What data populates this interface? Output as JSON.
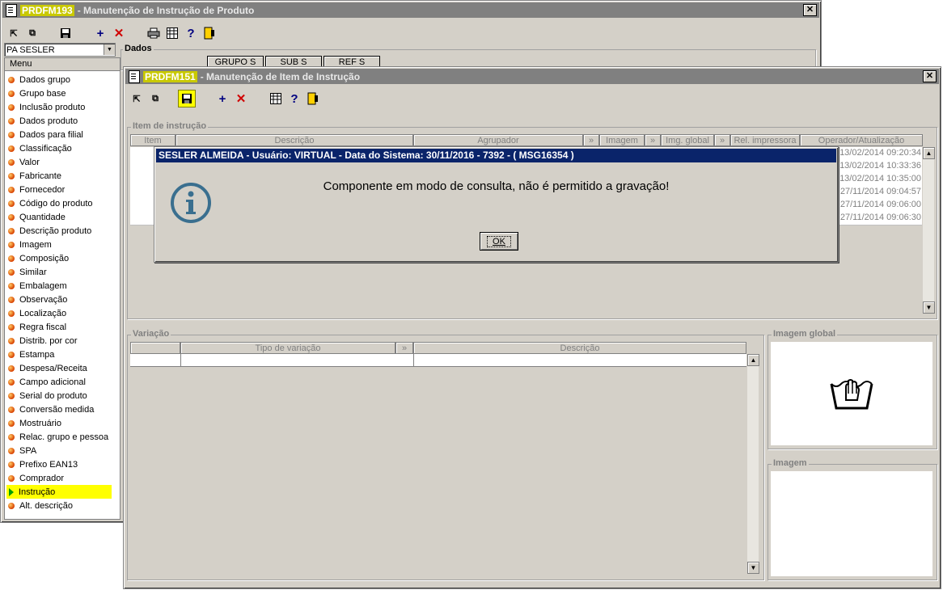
{
  "back_window": {
    "code": "PRDFM193",
    "title": "- Manutenção de Instrução de Produto",
    "combo_value": "PA SESLER",
    "menu_header": "Menu",
    "dados_label": "Dados",
    "tabs": [
      "GRUPO S",
      "SUB S",
      "REF S"
    ],
    "menu_items": [
      "Dados grupo",
      "Grupo base",
      "Inclusão produto",
      "Dados produto",
      "Dados para filial",
      "Classificação",
      "Valor",
      "Fabricante",
      "Fornecedor",
      "Código do produto",
      "Quantidade",
      "Descrição produto",
      "Imagem",
      "Composição",
      "Similar",
      "Embalagem",
      "Observação",
      "Localização",
      "Regra fiscal",
      "Distrib. por cor",
      "Estampa",
      "Despesa/Receita",
      "Campo adicional",
      "Serial do produto",
      "Conversão medida",
      "Mostruário",
      "Relac. grupo e pessoa",
      "SPA",
      "Prefixo EAN13",
      "Comprador",
      "Instrução",
      "Alt. descrição"
    ],
    "selected_item": "Instrução"
  },
  "front_window": {
    "code": "PRDFM151",
    "title": "- Manutenção de Item de Instrução",
    "item_group_label": "Item de instrução",
    "columns": [
      "Item",
      "Descrição",
      "Agrupador",
      "Imagem",
      "Img. global",
      "Rel. impressora",
      "Operador/Atualização"
    ],
    "operator_dates": [
      "13/02/2014 09:20:34",
      "13/02/2014 10:33:36",
      "13/02/2014 10:35:00",
      "27/11/2014 09:04:57",
      "27/11/2014 09:06:00",
      "27/11/2014 09:06:30"
    ],
    "variacao_label": "Variação",
    "variacao_columns": [
      "Tipo de variação",
      "Descrição"
    ],
    "imagem_global_label": "Imagem global",
    "imagem_label": "Imagem"
  },
  "dialog": {
    "title": "SESLER ALMEIDA - Usuário: VIRTUAL - Data do Sistema: 30/11/2016 - 7392 - ( MSG16354 )",
    "message": "Componente em modo de consulta, não é permitido a gravação!",
    "ok_label": "OK"
  },
  "colors": {
    "title_active": "#0a246a",
    "title_inactive": "#808080",
    "highlight": "#ffff00",
    "info_icon": "#3a6f8f"
  }
}
